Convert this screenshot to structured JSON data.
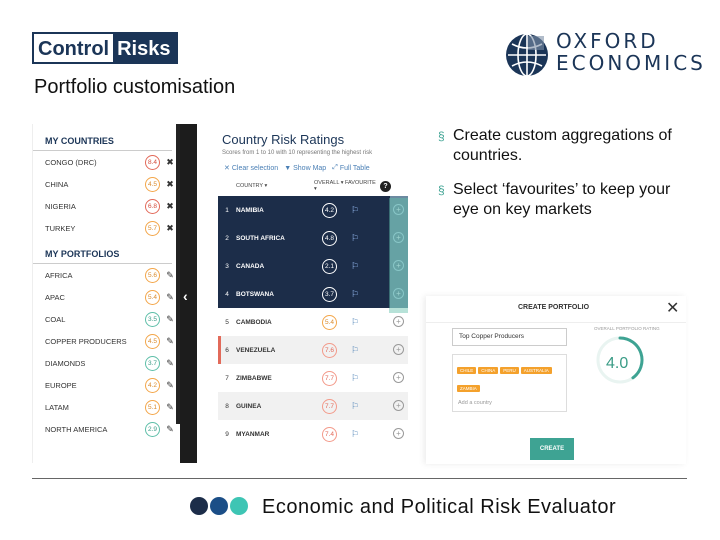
{
  "logos": {
    "control_risks_part1": "Control",
    "control_risks_part2": "Risks",
    "oxford_line1": "OXFORD",
    "oxford_line2": "ECONOMICS"
  },
  "slide_title": "Portfolio customisation",
  "left_panel": {
    "my_countries_heading": "MY COUNTRIES",
    "my_countries": [
      {
        "name": "CONGO (DRC)",
        "score": "8.4",
        "level": "red"
      },
      {
        "name": "CHINA",
        "score": "4.5",
        "level": "orange"
      },
      {
        "name": "NIGERIA",
        "score": "6.8",
        "level": "red"
      },
      {
        "name": "TURKEY",
        "score": "5.7",
        "level": "orange"
      }
    ],
    "my_portfolios_heading": "MY PORTFOLIOS",
    "my_portfolios": [
      {
        "name": "AFRICA",
        "score": "5.6",
        "level": "orange"
      },
      {
        "name": "APAC",
        "score": "5.4",
        "level": "orange"
      },
      {
        "name": "COAL",
        "score": "3.5",
        "level": "green"
      },
      {
        "name": "COPPER PRODUCERS",
        "score": "4.5",
        "level": "orange"
      },
      {
        "name": "DIAMONDS",
        "score": "3.7",
        "level": "green"
      },
      {
        "name": "EUROPE",
        "score": "4.2",
        "level": "orange"
      },
      {
        "name": "LATAM",
        "score": "5.1",
        "level": "orange"
      },
      {
        "name": "NORTH AMERICA",
        "score": "2.9",
        "level": "green"
      }
    ]
  },
  "middle_panel": {
    "title": "Country Risk Ratings",
    "subtitle": "Scores from 1 to 10 with 10 representing the highest risk",
    "actions": {
      "clear_selection": "Clear selection",
      "show_map": "Show Map",
      "full_table": "Full Table"
    },
    "col_country": "COUNTRY ▾",
    "col_overall": "OVERALL ▾ FAVOURITE ▾",
    "help": "?",
    "rows": [
      {
        "rank": "1",
        "name": "NAMIBIA",
        "score": "4.2",
        "state": "sel"
      },
      {
        "rank": "2",
        "name": "SOUTH AFRICA",
        "score": "4.8",
        "state": "sel"
      },
      {
        "rank": "3",
        "name": "CANADA",
        "score": "2.1",
        "state": "sel"
      },
      {
        "rank": "4",
        "name": "BOTSWANA",
        "score": "3.7",
        "state": "sel"
      },
      {
        "rank": "5",
        "name": "CAMBODIA",
        "score": "5.4",
        "state": "norm"
      },
      {
        "rank": "6",
        "name": "VENEZUELA",
        "score": "7.6",
        "state": "alt"
      },
      {
        "rank": "7",
        "name": "ZIMBABWE",
        "score": "7.7",
        "state": "norm"
      },
      {
        "rank": "8",
        "name": "GUINEA",
        "score": "7.7",
        "state": "alt"
      },
      {
        "rank": "9",
        "name": "MYANMAR",
        "score": "7.4",
        "state": "norm"
      }
    ]
  },
  "bullets": [
    "Create custom aggregations of countries.",
    "Select ‘favourites’ to keep your eye on key markets"
  ],
  "create_portfolio": {
    "title": "CREATE PORTFOLIO",
    "close": "✕",
    "name_value": "Top Copper Producers",
    "tags": [
      "CHILE",
      "CHINA",
      "PERU",
      "AUSTRALIA",
      "ZAMBIA"
    ],
    "add_placeholder": "Add a country",
    "overall_label": "OVERALL PORTFOLIO RATING",
    "overall_value": "4.0",
    "overall_fraction": 0.4,
    "create_button": "CREATE"
  },
  "footer": {
    "text": "Economic and Political Risk Evaluator",
    "dot_colors": [
      "#1c2d49",
      "#1b4e87",
      "#3ec5b4"
    ]
  },
  "colors": {
    "navy": "#1b3557",
    "teal": "#3ea393",
    "orange": "#f3a64a",
    "red": "#e26a5a"
  }
}
